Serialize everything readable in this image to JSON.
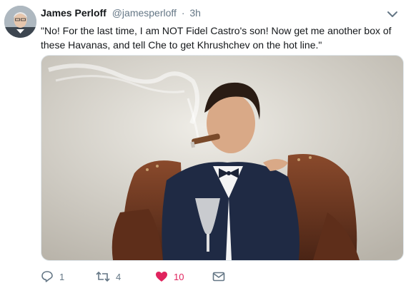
{
  "tweet": {
    "author_name": "James Perloff",
    "author_handle": "@jamesperloff",
    "separator": "·",
    "timestamp": "3h",
    "text": "\"No! For the last time, I am NOT Fidel Castro's son! Now get me another box of these Havanas, and tell Che to get Khrushchev on the hot line.\"",
    "media_icon": "photo-cigar-armchair-image",
    "caret_icon": "chevron-down-icon"
  },
  "actions": {
    "reply": {
      "icon": "reply-icon",
      "count": "1"
    },
    "retweet": {
      "icon": "retweet-icon",
      "count": "4"
    },
    "like": {
      "icon": "heart-icon",
      "count": "10",
      "active": true
    },
    "dm": {
      "icon": "envelope-icon"
    }
  },
  "colors": {
    "text": "#14171a",
    "secondary": "#657786",
    "like": "#e0245e",
    "border": "#e1e8ed"
  }
}
